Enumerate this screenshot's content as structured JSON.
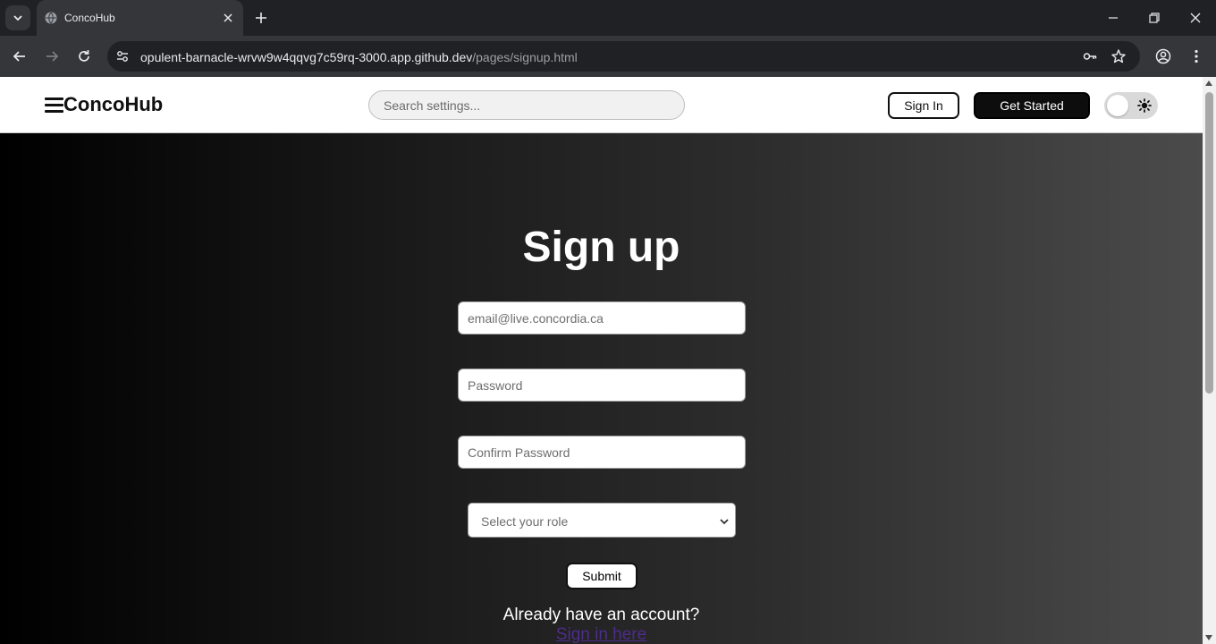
{
  "browser": {
    "tab_title": "ConcoHub",
    "url_host": "opulent-barnacle-wrvw9w4qqvg7c59rq-3000.app.github.dev",
    "url_path": "/pages/signup.html"
  },
  "header": {
    "brand": "ConcoHub",
    "search_placeholder": "Search settings...",
    "sign_in_label": "Sign In",
    "get_started_label": "Get Started"
  },
  "form": {
    "title": "Sign up",
    "email_placeholder": "email@live.concordia.ca",
    "password_placeholder": "Password",
    "confirm_placeholder": "Confirm Password",
    "role_selected": "Select your role",
    "submit_label": "Submit",
    "already_text": "Already have an account?",
    "signin_link_text": "Sign in here"
  },
  "colors": {
    "hero_gradient_start": "#000000",
    "hero_gradient_end": "#4b4b4b",
    "primary_button": "#0d0d0d",
    "link": "#4d2c8c"
  }
}
